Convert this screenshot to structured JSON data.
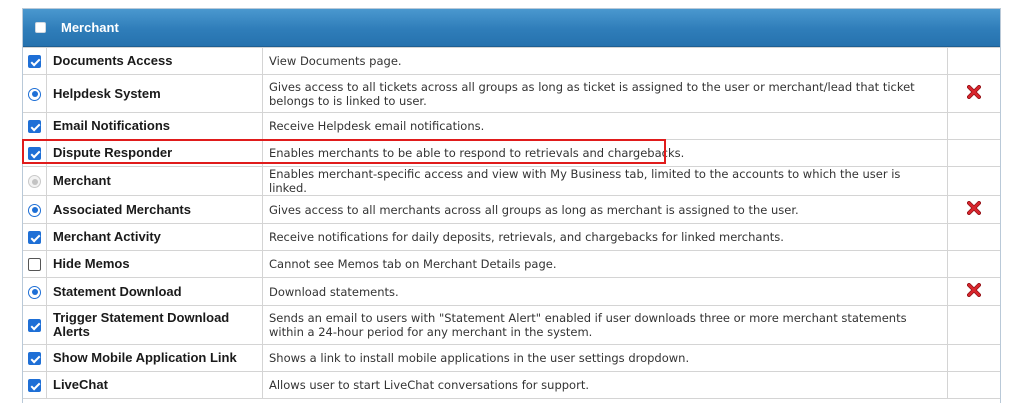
{
  "section": {
    "title": "Merchant",
    "header_checkbox": "unchecked"
  },
  "rows": [
    {
      "control": "checkbox-checked",
      "name": "Documents Access",
      "desc": "View Documents page.",
      "remove": false
    },
    {
      "control": "radio-selected",
      "name": "Helpdesk System",
      "desc": "Gives access to all tickets across all groups as long as ticket is assigned to the user or merchant/lead that ticket belongs to is linked to user.",
      "remove": true
    },
    {
      "control": "checkbox-checked",
      "name": "Email Notifications",
      "desc": "Receive Helpdesk email notifications.",
      "remove": false
    },
    {
      "control": "checkbox-checked",
      "name": "Dispute Responder",
      "desc": "Enables merchants to be able to respond to retrievals and chargebacks.",
      "remove": false,
      "highlighted": true
    },
    {
      "control": "radio-disabled",
      "name": "Merchant",
      "desc": "Enables merchant-specific access and view with My Business tab, limited to the accounts to which the user is linked.",
      "remove": false
    },
    {
      "control": "radio-selected",
      "name": "Associated Merchants",
      "desc": "Gives access to all merchants across all groups as long as merchant is assigned to the user.",
      "remove": true
    },
    {
      "control": "checkbox-checked",
      "name": "Merchant Activity",
      "desc": "Receive notifications for daily deposits, retrievals, and chargebacks for linked merchants.",
      "remove": false
    },
    {
      "control": "checkbox-unchecked",
      "name": "Hide Memos",
      "desc": "Cannot see Memos tab on Merchant Details page.",
      "remove": false
    },
    {
      "control": "radio-selected",
      "name": "Statement Download",
      "desc": "Download statements.",
      "remove": true
    },
    {
      "control": "checkbox-checked",
      "name": "Trigger Statement Download Alerts",
      "desc": "Sends an email to users with \"Statement Alert\" enabled if user downloads three or more merchant statements within a 24-hour period for any merchant in the system.",
      "remove": false
    },
    {
      "control": "checkbox-checked",
      "name": "Show Mobile Application Link",
      "desc": "Shows a link to install mobile applications in the user settings dropdown.",
      "remove": false
    },
    {
      "control": "checkbox-checked",
      "name": "LiveChat",
      "desc": "Allows user to start LiveChat conversations for support.",
      "remove": false
    }
  ],
  "colors": {
    "header": "#2f7db9",
    "control": "#1e6fd6",
    "remove_icon": "#d9262d",
    "highlight": "#e01b1b"
  }
}
